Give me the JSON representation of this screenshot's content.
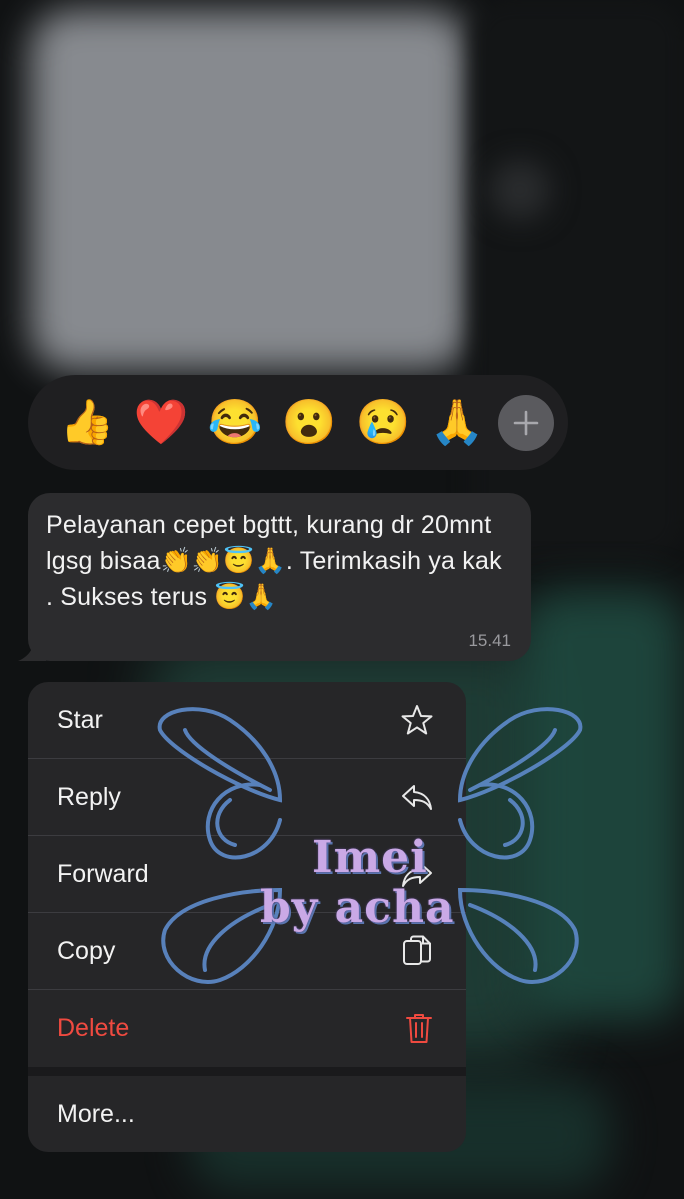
{
  "reactions": {
    "emojis": [
      {
        "icon": "thumbs-up-icon",
        "glyph": "👍"
      },
      {
        "icon": "red-heart-icon",
        "glyph": "❤️"
      },
      {
        "icon": "tears-of-joy-icon",
        "glyph": "😂"
      },
      {
        "icon": "surprised-face-icon",
        "glyph": "😮"
      },
      {
        "icon": "crying-face-icon",
        "glyph": "😢"
      },
      {
        "icon": "folded-hands-icon",
        "glyph": "🙏"
      }
    ],
    "more_label": "+"
  },
  "message": {
    "text": "Pelayanan cepet bgttt, kurang dr 20mnt lgsg bisaa👏👏😇🙏. Terimkasih ya kak . Sukses terus 😇🙏",
    "time": "15.41"
  },
  "menu": {
    "items": [
      {
        "label": "Star",
        "icon": "star-icon"
      },
      {
        "label": "Reply",
        "icon": "reply-icon"
      },
      {
        "label": "Forward",
        "icon": "forward-icon"
      },
      {
        "label": "Copy",
        "icon": "copy-icon"
      },
      {
        "label": "Delete",
        "icon": "trash-icon"
      },
      {
        "label": "More..."
      }
    ]
  },
  "watermark": {
    "line1": "Imei",
    "line2": "by acha"
  },
  "colors": {
    "bubble": "#2c2c2e",
    "menu": "#262628",
    "delete": "#ef4a40",
    "watermark_text": "#caa9e6",
    "watermark_wings": "#5b86c3"
  }
}
